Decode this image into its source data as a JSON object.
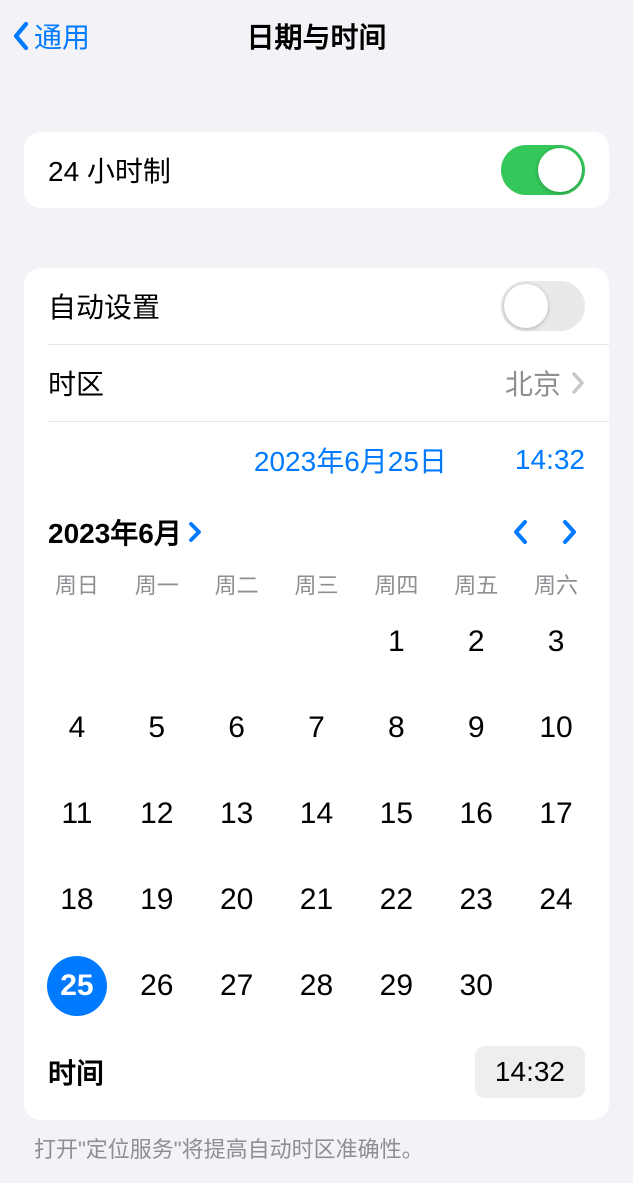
{
  "nav": {
    "back": "通用",
    "title": "日期与时间"
  },
  "clock24": {
    "label": "24 小时制",
    "on": true
  },
  "auto": {
    "label": "自动设置",
    "on": false
  },
  "timezone": {
    "label": "时区",
    "value": "北京"
  },
  "picker": {
    "date": "2023年6月25日",
    "time": "14:32"
  },
  "month": {
    "label": "2023年6月"
  },
  "weekdays": [
    "周日",
    "周一",
    "周二",
    "周三",
    "周四",
    "周五",
    "周六"
  ],
  "calendar": {
    "leading_blanks": 4,
    "days": [
      1,
      2,
      3,
      4,
      5,
      6,
      7,
      8,
      9,
      10,
      11,
      12,
      13,
      14,
      15,
      16,
      17,
      18,
      19,
      20,
      21,
      22,
      23,
      24,
      25,
      26,
      27,
      28,
      29,
      30
    ],
    "selected": 25
  },
  "timeRow": {
    "label": "时间",
    "value": "14:32"
  },
  "footnote": "打开\"定位服务\"将提高自动时区准确性。"
}
